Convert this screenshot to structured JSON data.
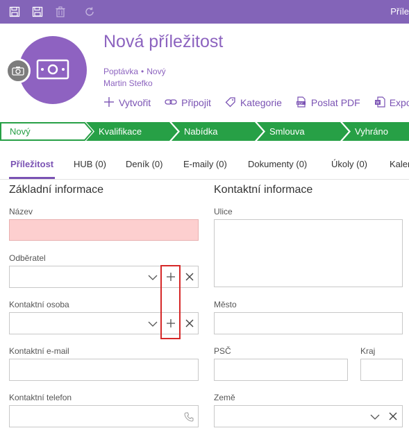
{
  "toolbar": {
    "title": "Příle",
    "icons": [
      "save-close-icon",
      "save-icon",
      "delete-icon",
      "refresh-icon"
    ]
  },
  "header": {
    "title": "Nová příležitost",
    "type": "Poptávka",
    "status": "Nový",
    "owner": "Martin Stefko",
    "actions": [
      {
        "label": "Vytvořit",
        "icon": "plus-icon"
      },
      {
        "label": "Připojit",
        "icon": "link-icon"
      },
      {
        "label": "Kategorie",
        "icon": "tag-icon"
      },
      {
        "label": "Poslat PDF",
        "icon": "pdf-icon"
      },
      {
        "label": "Expo",
        "icon": "export-icon"
      }
    ]
  },
  "stages": [
    {
      "label": "Nový",
      "active": true
    },
    {
      "label": "Kvalifikace"
    },
    {
      "label": "Nabídka"
    },
    {
      "label": "Smlouva"
    },
    {
      "label": "Vyhráno"
    }
  ],
  "tabs": [
    {
      "label": "Příležitost",
      "active": true
    },
    {
      "label": "HUB (0)"
    },
    {
      "label": "Deník (0)"
    },
    {
      "label": "E-maily (0)"
    },
    {
      "label": "Dokumenty (0)"
    },
    {
      "label": "Úkoly (0)"
    },
    {
      "label": "Kaler"
    }
  ],
  "basic": {
    "title": "Základní informace",
    "name_label": "Název",
    "customer_label": "Odběratel",
    "contact_label": "Kontaktní osoba",
    "email_label": "Kontaktní e-mail",
    "phone_label": "Kontaktní telefon"
  },
  "contact": {
    "title": "Kontaktní informace",
    "street_label": "Ulice",
    "city_label": "Město",
    "zip_label": "PSČ",
    "region_label": "Kraj",
    "country_label": "Země"
  },
  "colors": {
    "accent": "#8364b8",
    "stage_active_border": "#27a046",
    "stage_green": "#27a046",
    "error_field": "#fdcfcf",
    "highlight": "#d62828"
  }
}
